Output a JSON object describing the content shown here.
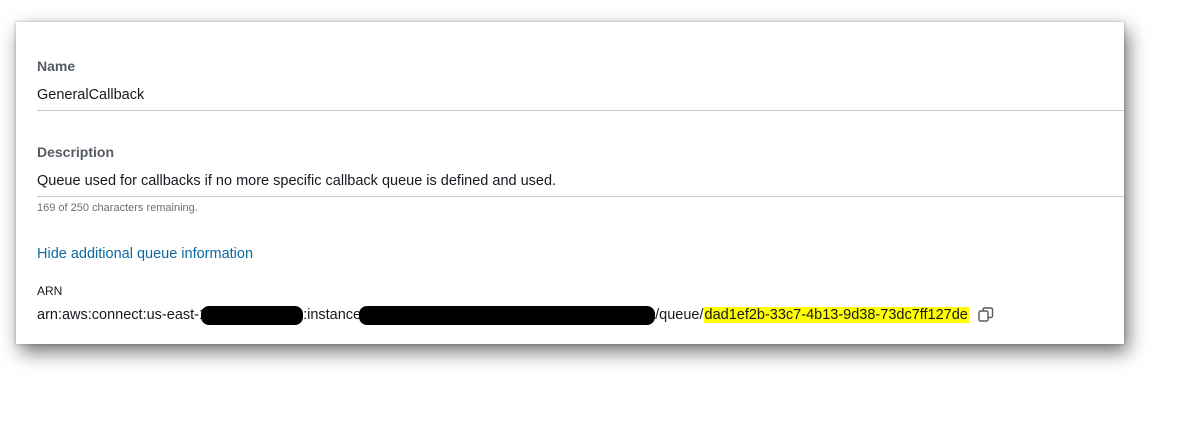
{
  "name": {
    "label": "Name",
    "value": "GeneralCallback"
  },
  "description": {
    "label": "Description",
    "value": "Queue used for callbacks if no more specific callback queue  is defined and used.",
    "remaining_hint": "169 of 250 characters remaining."
  },
  "toggle_link": "Hide additional queue information",
  "arn": {
    "label": "ARN",
    "prefix": "arn:aws:connect:us-east-1",
    "segment_instance": ":instance",
    "segment_queue": "/queue/",
    "queue_id": "dad1ef2b-33c7-4b13-9d38-73dc7ff127de"
  },
  "colors": {
    "link": "#0a6aa1",
    "highlight": "#ffff00",
    "redaction": "#000000"
  },
  "icons": {
    "copy": "copy-icon"
  }
}
